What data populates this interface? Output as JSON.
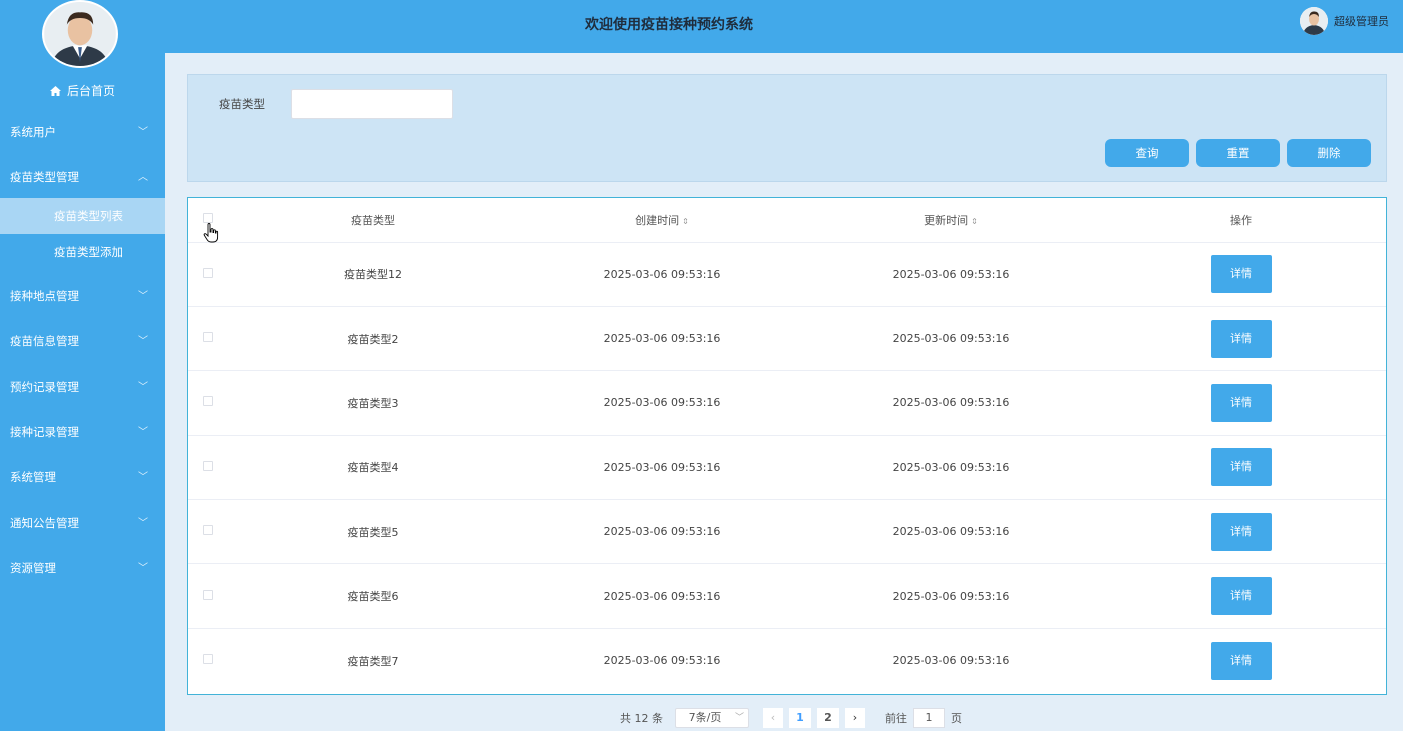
{
  "header": {
    "title": "欢迎使用疫苗接种预约系统",
    "username": "超级管理员"
  },
  "sidebar": {
    "home": "后台首页",
    "menu": [
      {
        "label": "系统用户"
      },
      {
        "label": "疫苗类型管理",
        "expanded": true,
        "children": [
          "疫苗类型列表",
          "疫苗类型添加"
        ]
      },
      {
        "label": "接种地点管理"
      },
      {
        "label": "疫苗信息管理"
      },
      {
        "label": "预约记录管理"
      },
      {
        "label": "接种记录管理"
      },
      {
        "label": "系统管理"
      },
      {
        "label": "通知公告管理"
      },
      {
        "label": "资源管理"
      }
    ]
  },
  "search": {
    "label": "疫苗类型",
    "value": "",
    "query_btn": "查询",
    "reset_btn": "重置",
    "delete_btn": "删除"
  },
  "table": {
    "columns": [
      "疫苗类型",
      "创建时间",
      "更新时间",
      "操作"
    ],
    "rows": [
      {
        "type": "疫苗类型12",
        "created": "2025-03-06 09:53:16",
        "updated": "2025-03-06 09:53:16",
        "action": "详情"
      },
      {
        "type": "疫苗类型2",
        "created": "2025-03-06 09:53:16",
        "updated": "2025-03-06 09:53:16",
        "action": "详情"
      },
      {
        "type": "疫苗类型3",
        "created": "2025-03-06 09:53:16",
        "updated": "2025-03-06 09:53:16",
        "action": "详情"
      },
      {
        "type": "疫苗类型4",
        "created": "2025-03-06 09:53:16",
        "updated": "2025-03-06 09:53:16",
        "action": "详情"
      },
      {
        "type": "疫苗类型5",
        "created": "2025-03-06 09:53:16",
        "updated": "2025-03-06 09:53:16",
        "action": "详情"
      },
      {
        "type": "疫苗类型6",
        "created": "2025-03-06 09:53:16",
        "updated": "2025-03-06 09:53:16",
        "action": "详情"
      },
      {
        "type": "疫苗类型7",
        "created": "2025-03-06 09:53:16",
        "updated": "2025-03-06 09:53:16",
        "action": "详情"
      }
    ]
  },
  "pagination": {
    "total": "共 12 条",
    "page_size": "7条/页",
    "pages": [
      "1",
      "2"
    ],
    "current": "1",
    "goto_label": "前往",
    "goto_value": "1",
    "page_suffix": "页"
  },
  "colors": {
    "primary": "#42a9ea",
    "active_sub": "#a9d6f4",
    "page_bg": "#e3eef8"
  }
}
